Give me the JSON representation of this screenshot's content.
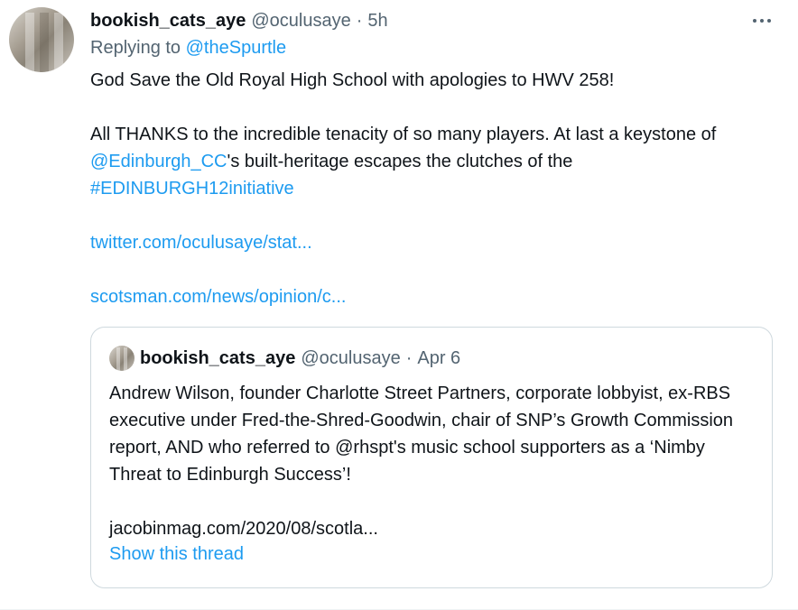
{
  "tweet": {
    "author_name": "bookish_cats_aye",
    "author_handle": "@oculusaye",
    "separator": "·",
    "time": "5h",
    "replying_prefix": "Replying to",
    "replying_handle": "@theSpurtle",
    "line1": "God Save the Old Royal High School with apologies to HWV 258!",
    "para2_a": "All THANKS to the incredible tenacity of so many players. At last a keystone of ",
    "para2_mention": "@Edinburgh_CC",
    "para2_b": "'s built-heritage escapes the clutches of the",
    "hashtag": "#EDINBURGH12initiative",
    "link1": "twitter.com/oculusaye/stat...",
    "link2": "scotsman.com/news/opinion/c..."
  },
  "quote": {
    "author_name": "bookish_cats_aye",
    "author_handle": "@oculusaye",
    "separator": "·",
    "date": "Apr 6",
    "text": "Andrew Wilson, founder Charlotte Street Partners, corporate lobbyist, ex-RBS executive under Fred-the-Shred-Goodwin, chair of SNP’s Growth Commission report, AND who referred to @rhspt's music school supporters as a ‘Nimby Threat to Edinburgh Success’!",
    "link": "jacobinmag.com/2020/08/scotla...",
    "show_thread": "Show this thread"
  },
  "colors": {
    "accent": "#1d9bf0",
    "text": "#0f1419",
    "secondary": "#536471",
    "border": "#cfd9de"
  },
  "icons": {
    "more": "more-horizontal-icon"
  }
}
